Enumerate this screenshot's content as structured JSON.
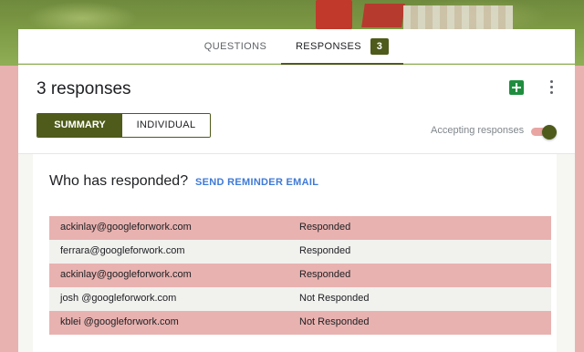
{
  "tabs": {
    "questions_label": "QUESTIONS",
    "responses_label": "RESPONSES",
    "responses_count": "3"
  },
  "header": {
    "title": "3 responses",
    "sheets_icon": "sheets-icon",
    "more_icon": "more-vert-icon"
  },
  "view_toggle": {
    "summary_label": "SUMMARY",
    "individual_label": "INDIVIDUAL",
    "selected": "SUMMARY"
  },
  "accepting": {
    "label": "Accepting responses",
    "on": true
  },
  "respondents": {
    "heading": "Who has responded?",
    "reminder_label": "SEND REMINDER EMAIL",
    "rows": [
      {
        "email": "ackinlay@googleforwork.com",
        "status": "Responded"
      },
      {
        "email": "ferrara@googleforwork.com",
        "status": "Responded"
      },
      {
        "email": "ackinlay@googleforwork.com",
        "status": "Responded"
      },
      {
        "email": "josh @googleforwork.com",
        "status": "Not Responded"
      },
      {
        "email": "kblei @googleforwork.com",
        "status": "Not Responded"
      }
    ]
  },
  "colors": {
    "accent": "#4e5b1a",
    "row_highlight": "#e8b2b0",
    "row_alt": "#f1f1ee",
    "link": "#3f7ad6"
  }
}
